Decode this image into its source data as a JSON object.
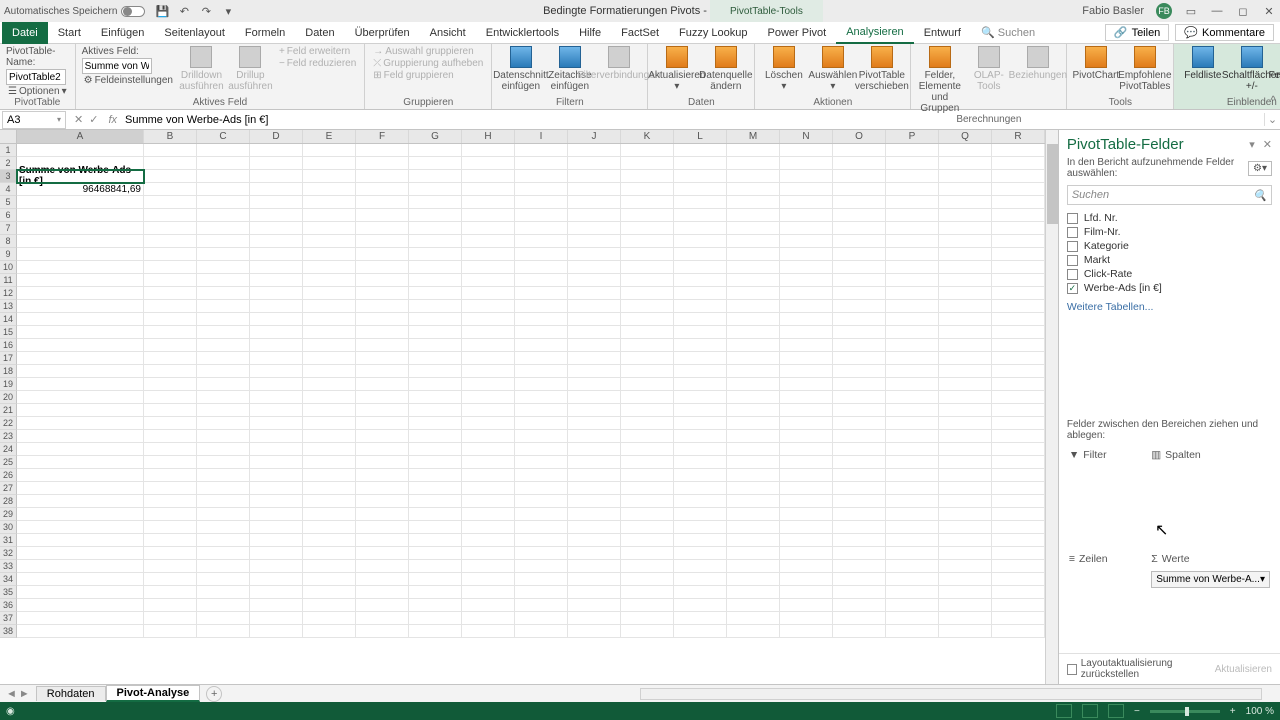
{
  "titlebar": {
    "autosave": "Automatisches Speichern",
    "doc_title": "Bedingte Formatierungen Pivots  -  Excel",
    "pivot_tools": "PivotTable-Tools",
    "user": "Fabio Basler",
    "avatar": "FB"
  },
  "tabs": {
    "file": "Datei",
    "items": [
      "Start",
      "Einfügen",
      "Seitenlayout",
      "Formeln",
      "Daten",
      "Überprüfen",
      "Ansicht",
      "Entwicklertools",
      "Hilfe",
      "FactSet",
      "Fuzzy Lookup",
      "Power Pivot",
      "Analysieren",
      "Entwurf"
    ],
    "search_icon": "🔍",
    "search": "Suchen",
    "share": "Teilen",
    "comments": "Kommentare"
  },
  "ribbon": {
    "pivottable": {
      "name_label": "PivotTable-Name:",
      "name_value": "PivotTable2",
      "options": "Optionen",
      "group": "PivotTable"
    },
    "active_field": {
      "label": "Aktives Feld:",
      "value": "Summe von Werb",
      "settings": "Feldeinstellungen",
      "drilldown": "Drilldown ausführen",
      "drillup": "Drillup ausführen",
      "expand": "Feld erweitern",
      "reduce": "Feld reduzieren",
      "group": "Aktives Feld"
    },
    "grouping": {
      "sel": "Auswahl gruppieren",
      "ungroup": "Gruppierung aufheben",
      "groupfield": "Feld gruppieren",
      "group": "Gruppieren"
    },
    "filter": {
      "slicer1": "Datenschnitt",
      "slicer2": "einfügen",
      "timeline1": "Zeitachse",
      "timeline2": "einfügen",
      "conn": "Filterverbindungen",
      "group": "Filtern"
    },
    "data": {
      "refresh": "Aktualisieren",
      "change1": "Datenquelle",
      "change2": "ändern",
      "group": "Daten"
    },
    "actions": {
      "clear": "Löschen",
      "select": "Auswählen",
      "move1": "PivotTable",
      "move2": "verschieben",
      "group": "Aktionen"
    },
    "calc": {
      "fields1": "Felder, Elemente",
      "fields2": "und Gruppen",
      "olap1": "OLAP-",
      "olap2": "Tools",
      "rel": "Beziehungen",
      "group": "Berechnungen"
    },
    "tools": {
      "chart": "PivotChart",
      "rec1": "Empfohlene",
      "rec2": "PivotTables",
      "group": "Tools"
    },
    "show": {
      "fieldlist": "Feldliste",
      "buttons1": "Schaltflächen",
      "buttons2": "+/-",
      "headers": "Feldkopfzeilen",
      "group": "Einblenden"
    }
  },
  "formula": {
    "namebox": "A3",
    "value": "Summe von Werbe-Ads [in €]"
  },
  "columns": [
    "A",
    "B",
    "C",
    "D",
    "E",
    "F",
    "G",
    "H",
    "I",
    "J",
    "K",
    "L",
    "M",
    "N",
    "O",
    "P",
    "Q",
    "R"
  ],
  "cells": {
    "a3": "Summe von Werbe-Ads [in €]",
    "a4": "96468841,69"
  },
  "panel": {
    "title": "PivotTable-Felder",
    "sub": "In den Bericht aufzunehmende Felder auswählen:",
    "search": "Suchen",
    "fields": [
      {
        "name": "Lfd. Nr.",
        "checked": false
      },
      {
        "name": "Film-Nr.",
        "checked": false
      },
      {
        "name": "Kategorie",
        "checked": false
      },
      {
        "name": "Markt",
        "checked": false
      },
      {
        "name": "Click-Rate",
        "checked": false
      },
      {
        "name": "Werbe-Ads [in €]",
        "checked": true
      }
    ],
    "more": "Weitere Tabellen...",
    "drag_label": "Felder zwischen den Bereichen ziehen und ablegen:",
    "areas": {
      "filter": "Filter",
      "columns": "Spalten",
      "rows": "Zeilen",
      "values": "Werte"
    },
    "value_item": "Summe von Werbe-A...",
    "defer": "Layoutaktualisierung zurückstellen",
    "update": "Aktualisieren"
  },
  "sheets": {
    "tabs": [
      "Rohdaten",
      "Pivot-Analyse"
    ],
    "active": 1
  },
  "status": {
    "zoom": "100 %"
  }
}
